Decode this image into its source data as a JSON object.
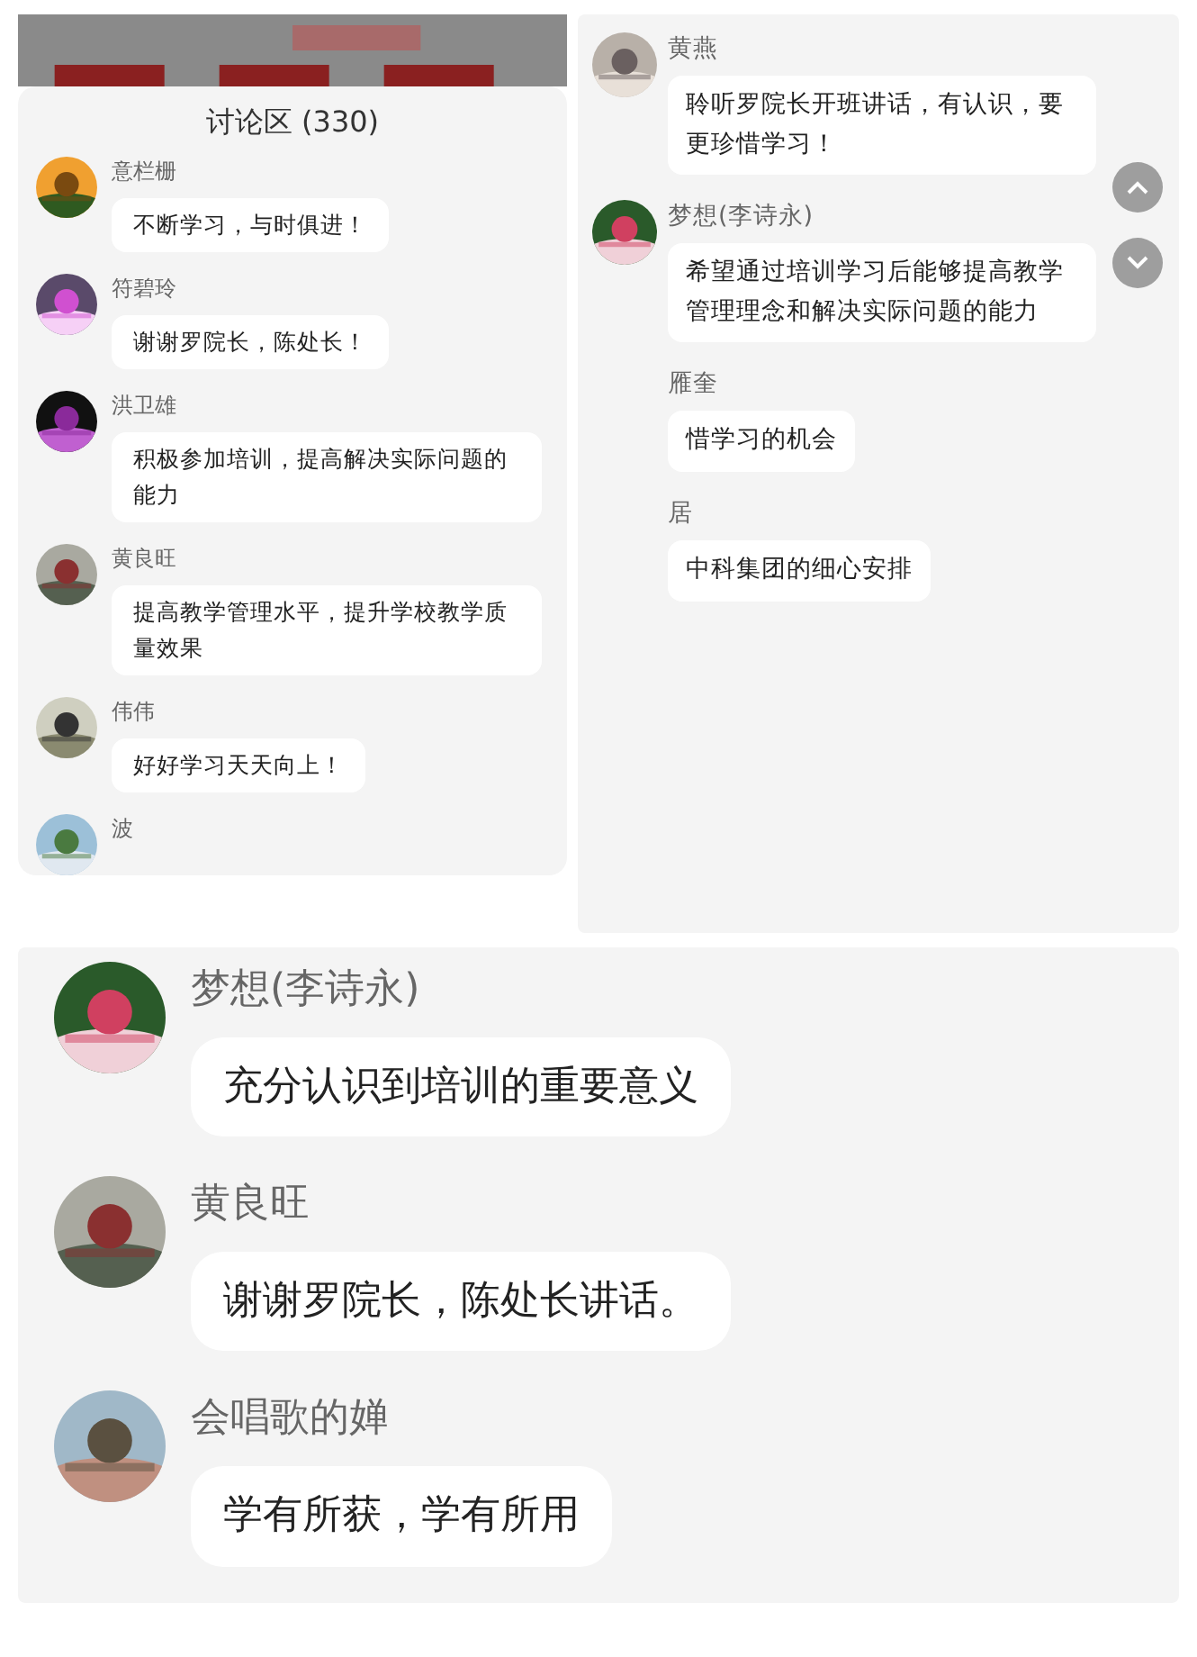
{
  "left_panel": {
    "title": "讨论区 (330)",
    "comments": [
      {
        "name": "意栏栅",
        "message": "不断学习，与时俱进！"
      },
      {
        "name": "符碧玲",
        "message": "谢谢罗院长，陈处长！"
      },
      {
        "name": "洪卫雄",
        "message": "积极参加培训，提高解决实际问题的能力"
      },
      {
        "name": "黄良旺",
        "message": "提高教学管理水平，提升学校教学质量效果"
      },
      {
        "name": "伟伟",
        "message": "好好学习天天向上！"
      },
      {
        "name": "波"
      }
    ]
  },
  "right_panel": {
    "comments": [
      {
        "name": "黄燕",
        "message": "聆听罗院长开班讲话，有认识，要更珍惜学习！",
        "avatar": true
      },
      {
        "name": "梦想(李诗永)",
        "message": "希望通过培训学习后能够提高教学管理理念和解决实际问题的能力",
        "avatar": true
      },
      {
        "name": "雁奎",
        "message": "惜学习的机会",
        "avatar": false
      },
      {
        "name": "居",
        "message": "中科集团的细心安排",
        "avatar": false
      }
    ],
    "scroll_buttons": [
      {
        "kind": "up"
      },
      {
        "kind": "down"
      }
    ]
  },
  "bottom_panel": {
    "comments": [
      {
        "name": "梦想(李诗永)",
        "message": "充分认识到培训的重要意义"
      },
      {
        "name": "黄良旺",
        "message": "谢谢罗院长，陈处长讲话。"
      },
      {
        "name": "会唱歌的婵",
        "message": "学有所获，学有所用"
      }
    ]
  }
}
